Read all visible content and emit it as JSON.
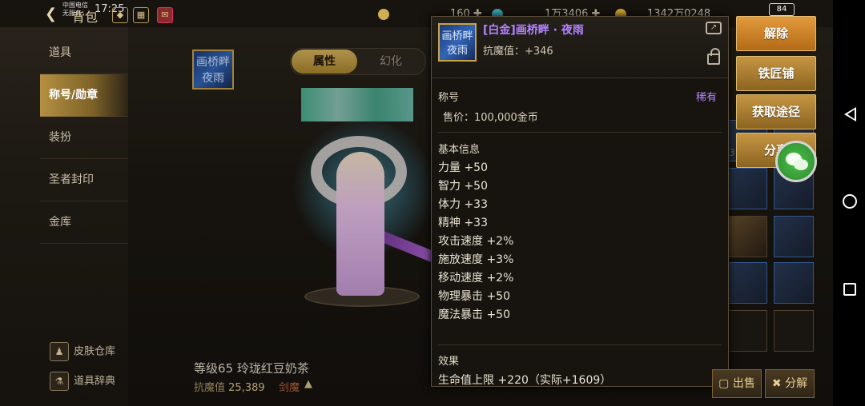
{
  "status_bar": {
    "carrier_line1": "中国电信",
    "carrier_line2": "无服务",
    "time": "17:25",
    "battery": "84"
  },
  "header": {
    "title": "背包",
    "icons": [
      "diamond-icon",
      "calendar-icon",
      "mailbox-icon"
    ],
    "currencies": [
      {
        "icon": "coin-icon",
        "value": ""
      },
      {
        "icon": "",
        "value": "160"
      },
      {
        "icon": "crystal-icon",
        "value": "1万3406"
      },
      {
        "icon": "gold-icon",
        "value": "1342万0248"
      }
    ]
  },
  "sidebar": {
    "items": [
      {
        "label": "道具"
      },
      {
        "label": "称号/勋章"
      },
      {
        "label": "装扮"
      },
      {
        "label": "圣者封印"
      },
      {
        "label": "金库"
      }
    ],
    "bottom": [
      {
        "label": "皮肤仓库"
      },
      {
        "label": "道具辞典"
      }
    ]
  },
  "title_badge": {
    "text": "画桥畔夜雨"
  },
  "tabs": [
    {
      "label": "属性"
    },
    {
      "label": "幻化"
    }
  ],
  "character": {
    "name": "等级65 玲珑红豆奶茶",
    "power_label": "抗魔值",
    "power_value": "25,389",
    "class": "剑魔"
  },
  "grid_numbers": [
    "3"
  ],
  "tooltip": {
    "item_name": "[白金]画桥畔 · 夜雨",
    "power": "抗魔值：+346",
    "category": "称号",
    "rarity": "稀有",
    "price": "售价：100,000金币",
    "basic_info_title": "基本信息",
    "stats": [
      "力量 +50",
      "智力 +50",
      "体力 +33",
      "精神 +33",
      "攻击速度 +2%",
      "施放速度 +3%",
      "移动速度 +2%",
      "物理暴击 +50",
      "魔法暴击 +50"
    ],
    "effect_title": "效果",
    "effect_line": "生命值上限 +220（实际+1609）"
  },
  "actions": {
    "remove": "解除",
    "blacksmith": "铁匠铺",
    "obtain": "获取途径",
    "share": "分享"
  },
  "bottom_buttons": {
    "sell": "出售",
    "decompose": "分解"
  },
  "colors": {
    "accent_gold": "#c59543",
    "rarity_purple": "#b284ff",
    "active_tab": "#d6b35d"
  }
}
